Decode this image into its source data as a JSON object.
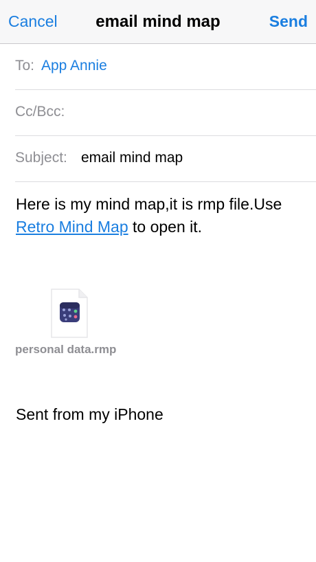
{
  "navbar": {
    "cancel_label": "Cancel",
    "title": "email mind map",
    "send_label": "Send"
  },
  "fields": {
    "to_label": "To:",
    "to_value": "App Annie",
    "ccbcc_label": "Cc/Bcc:",
    "subject_label": "Subject:",
    "subject_value": "email mind map"
  },
  "body": {
    "text_before_link": "Here is my mind map,it is rmp file.Use ",
    "link_text": "Retro Mind Map",
    "text_after_link": " to open it."
  },
  "attachment": {
    "file_name": "personal data.rmp",
    "icon": "rmp-file-icon"
  },
  "signature": "Sent from my iPhone",
  "colors": {
    "accent": "#1a7ee0",
    "secondary_text": "#8e8e93",
    "navbar_bg": "#f7f7f8",
    "separator": "#dcdcdf"
  }
}
